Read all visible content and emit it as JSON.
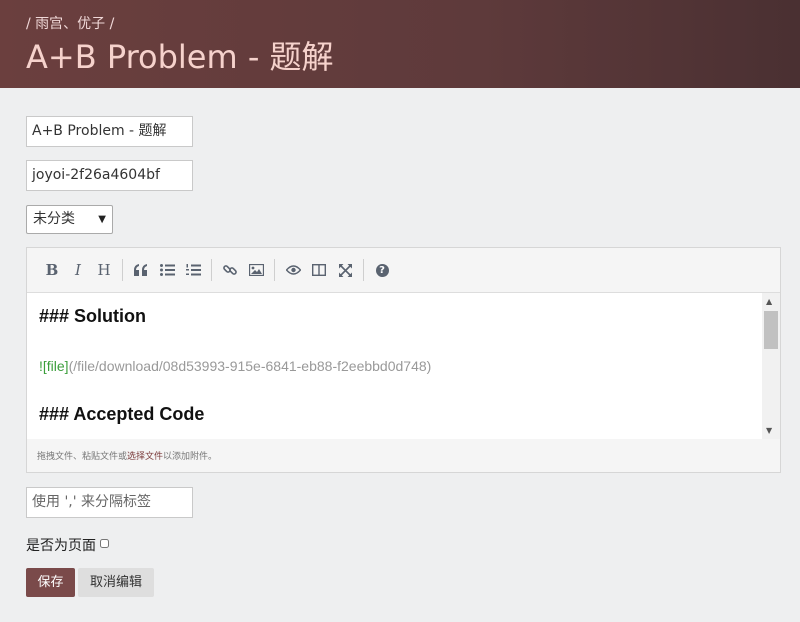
{
  "header": {
    "breadcrumb": "/ 雨宫、优子 /",
    "title": "A+B Problem - 题解"
  },
  "form": {
    "title_value": "A+B Problem - 题解",
    "url_value": "joyoi-2f26a4604bf",
    "category_value": "未分类",
    "tags_placeholder": "使用 ',' 来分隔标签",
    "is_page_label": "是否为页面",
    "save_label": "保存",
    "cancel_label": "取消编辑"
  },
  "editor": {
    "toolbar": {
      "bold": "B",
      "italic": "I",
      "heading": "H",
      "help": "?"
    },
    "lines": {
      "line1": "### Solution",
      "line2_bang": "![file]",
      "line2_rest": "(/file/download/08d53993-915e-6841-eb88-f2eebbd0d748)",
      "line3": "### Accepted Code"
    },
    "status_pre": "拖拽文件、粘贴文件或",
    "status_link": "选择文件",
    "status_post": "以添加附件。"
  }
}
